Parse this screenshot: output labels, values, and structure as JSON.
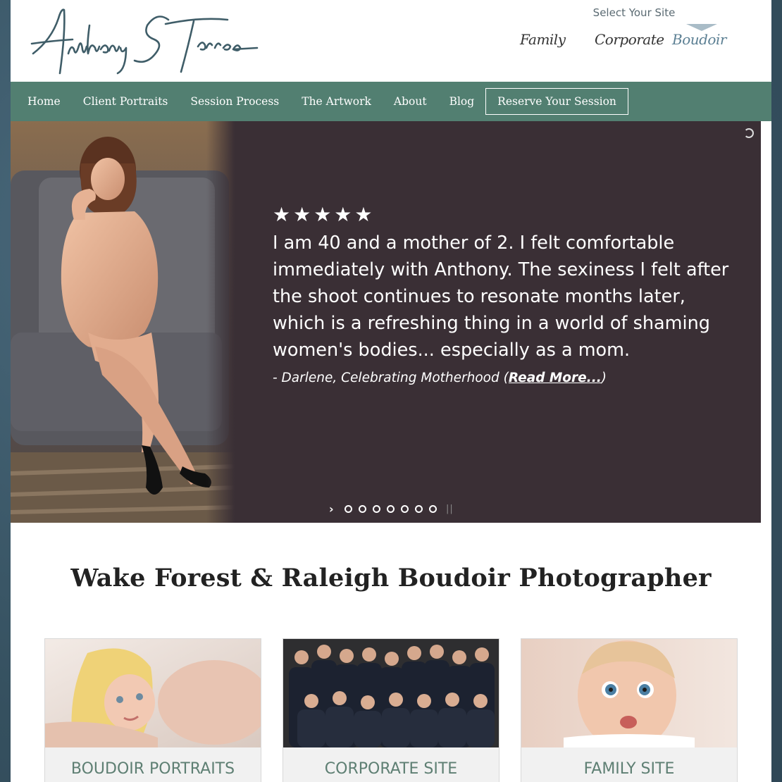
{
  "header": {
    "logo_text": "Anthony S Torres",
    "site_select_title": "Select Your Site",
    "sites": [
      {
        "label": "Family",
        "active": false
      },
      {
        "label": "Corporate",
        "active": false
      },
      {
        "label": "Boudoir",
        "active": true
      }
    ]
  },
  "nav": {
    "items": [
      "Home",
      "Client Portraits",
      "Session Process",
      "The Artwork",
      "About",
      "Blog"
    ],
    "cta": "Reserve Your Session"
  },
  "slider": {
    "stars": "★★★★★",
    "quote": "I am 40 and a mother of 2. I felt comfortable immediately with Anthony. The sexiness I felt after the shoot continues to resonate months later, which is a refreshing thing in a world of shaming women's bodies... especially as a mom.",
    "attribution_prefix": "- Darlene, Celebrating Motherhood (",
    "read_more": "Read More...",
    "attribution_suffix": ")",
    "dot_count": 7
  },
  "main": {
    "heading": "Wake Forest & Raleigh Boudoir Photographer"
  },
  "cards": [
    {
      "label": "BOUDOIR PORTRAITS"
    },
    {
      "label": "CORPORATE SITE"
    },
    {
      "label": "FAMILY SITE"
    }
  ],
  "colors": {
    "nav_bg": "#527f71",
    "slider_bg": "#3a2f35",
    "card_text": "#5e7f73",
    "background": "#3d5a6c"
  }
}
